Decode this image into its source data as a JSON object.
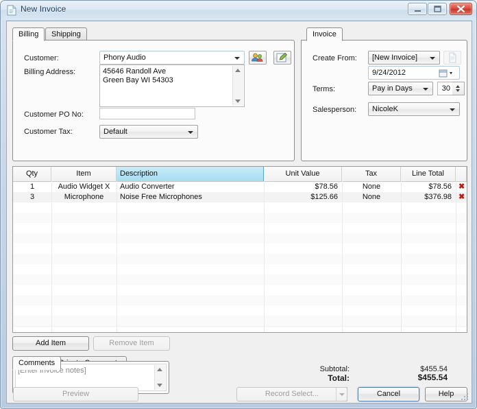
{
  "window": {
    "title": "New Invoice",
    "icon": "document-icon",
    "buttons": {
      "minimize": "minimize-icon",
      "maximize": "maximize-icon",
      "close": "close-icon"
    }
  },
  "billing": {
    "tabs": [
      {
        "label": "Billing",
        "active": true
      },
      {
        "label": "Shipping",
        "active": false
      }
    ],
    "fields": {
      "customer_label": "Customer:",
      "customer_value": "Phony Audio",
      "billing_address_label": "Billing Address:",
      "billing_address_value": "45646 Randoll Ave\nGreen Bay WI 54303",
      "customer_po_label": "Customer PO No:",
      "customer_po_value": "",
      "customer_tax_label": "Customer Tax:",
      "customer_tax_value": "Default"
    },
    "actions": {
      "select_customer": "customers-icon",
      "edit_customer": "edit-pencil-icon"
    }
  },
  "invoice": {
    "tabs": [
      {
        "label": "Invoice",
        "active": true
      }
    ],
    "fields": {
      "create_from_label": "Create From:",
      "create_from_value": "[New Invoice]",
      "date_value": "9/24/2012",
      "terms_label": "Terms:",
      "terms_value": "Pay in Days",
      "terms_days": "30",
      "salesperson_label": "Salesperson:",
      "salesperson_value": "NicoleK"
    },
    "actions": {
      "source_document": "document-icon",
      "date_picker": "calendar-icon"
    }
  },
  "grid": {
    "columns": [
      {
        "key": "qty",
        "label": "Qty",
        "selected": false
      },
      {
        "key": "item",
        "label": "Item",
        "selected": false
      },
      {
        "key": "description",
        "label": "Description",
        "selected": true
      },
      {
        "key": "unit_value",
        "label": "Unit Value",
        "selected": false
      },
      {
        "key": "tax",
        "label": "Tax",
        "selected": false
      },
      {
        "key": "line_total",
        "label": "Line Total",
        "selected": false
      }
    ],
    "rows": [
      {
        "qty": "1",
        "item": "Audio Widget X",
        "description": "Audio Converter",
        "unit_value": "$78.56",
        "tax": "None",
        "line_total": "$78.56",
        "delete": "delete-row-icon"
      },
      {
        "qty": "3",
        "item": "Microphone",
        "description": "Noise Free Microphones",
        "unit_value": "$125.66",
        "tax": "None",
        "line_total": "$376.98",
        "delete": "delete-row-icon"
      }
    ]
  },
  "item_actions": {
    "add_item": "Add Item",
    "remove_item": "Remove Item",
    "remove_item_disabled": true
  },
  "comments": {
    "tabs": [
      {
        "label": "Comments",
        "active": true
      },
      {
        "label": "Private Comments",
        "active": false
      }
    ],
    "placeholder": "[Enter invoice notes]",
    "value": ""
  },
  "totals": {
    "subtotal_label": "Subtotal:",
    "subtotal_value": "$455.54",
    "total_label": "Total:",
    "total_value": "$455.54"
  },
  "footer": {
    "preview": "Preview",
    "preview_disabled": true,
    "record_select": "Record Select...",
    "record_select_disabled": true,
    "cancel": "Cancel",
    "help": "Help"
  },
  "colors": {
    "selected_column": "#a7ddf0",
    "delete_icon": "#c01a12",
    "title_text": "#1b3a5c",
    "close_button": "#d9493a"
  }
}
